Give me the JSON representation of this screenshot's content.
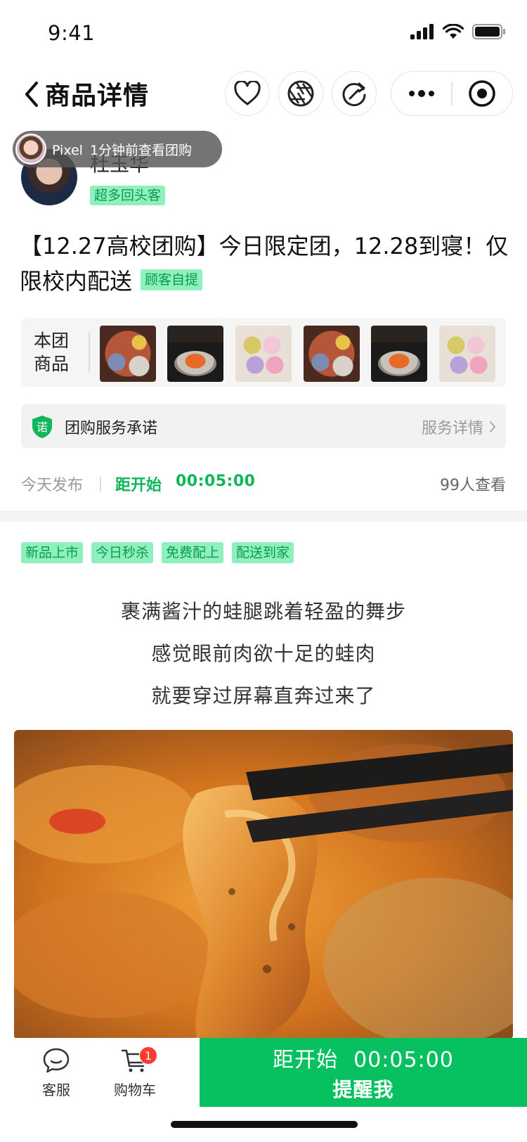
{
  "status_bar": {
    "time": "9:41"
  },
  "header": {
    "title": "商品详情"
  },
  "seller": {
    "name": "杜玉华",
    "badge": "超多回头客"
  },
  "toast": {
    "user": "Pixel",
    "message": "1分钟前查看团购"
  },
  "product": {
    "title": "【12.27高校团购】今日限定团，12.28到寝！仅限校内配送",
    "pickup_tag": "顾客自提"
  },
  "group_goods": {
    "label": "本团商品",
    "thumbs": [
      "food-platter",
      "soup-bowl",
      "colorful-buns",
      "food-platter",
      "soup-bowl",
      "colorful-buns"
    ]
  },
  "service": {
    "label": "团购服务承诺",
    "detail_link": "服务详情",
    "shield_text": "诺"
  },
  "meta": {
    "published": "今天发布",
    "countdown_label": "距开始",
    "countdown": "00:05:00",
    "views": "99人查看"
  },
  "tags": [
    "新品上市",
    "今日秒杀",
    "免费配上",
    "配送到家"
  ],
  "description": [
    "裹满酱汁的蛙腿跳着轻盈的舞步",
    "感觉眼前肉欲十足的蛙肉",
    "就要穿过屏幕直奔过来了"
  ],
  "bottom_bar": {
    "service_label": "客服",
    "cart_label": "购物车",
    "cart_count": "1",
    "remind_countdown_label": "距开始",
    "remind_countdown": "00:05:00",
    "remind_action": "提醒我"
  },
  "colors": {
    "accent": "#07c160",
    "tag_bg": "#8ff0bd",
    "tag_text": "#0a9a52"
  }
}
